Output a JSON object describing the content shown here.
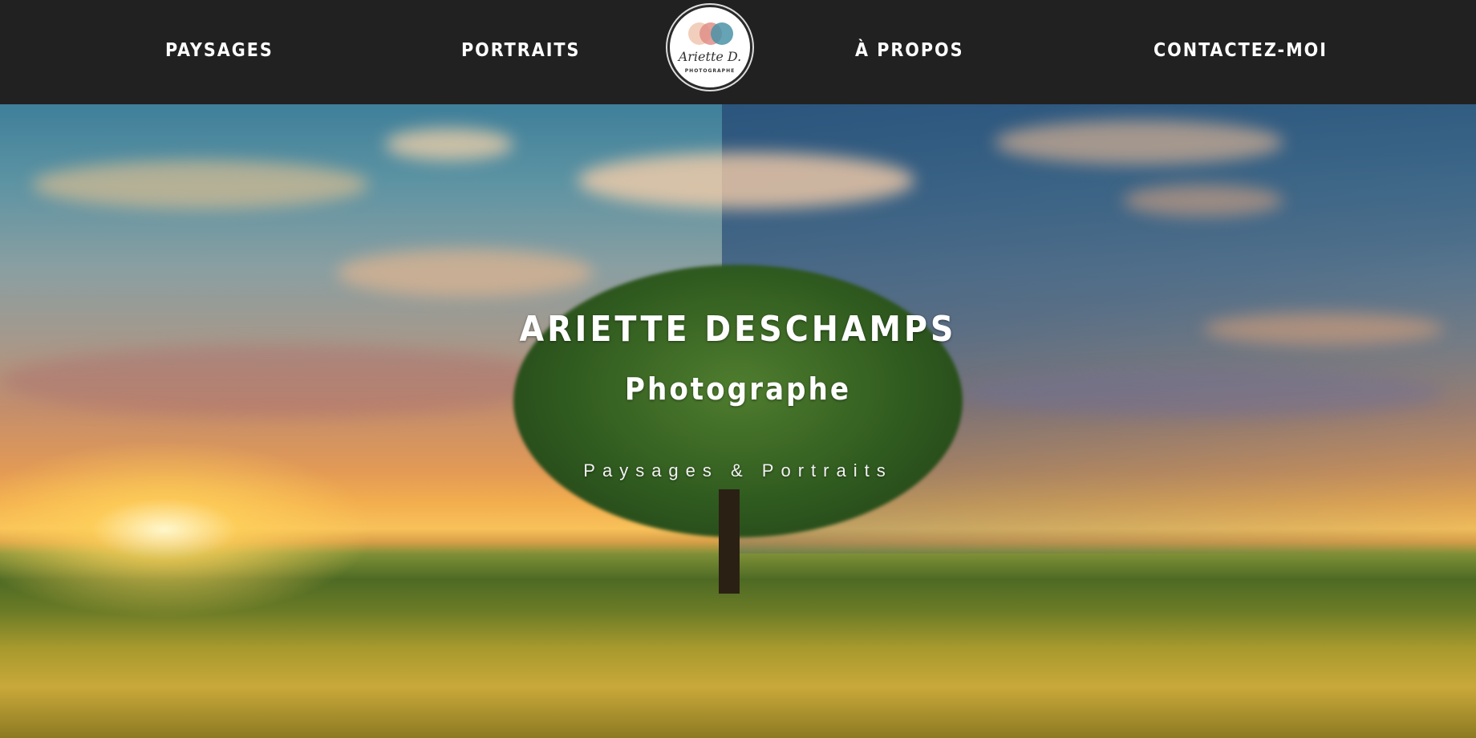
{
  "nav": {
    "items": [
      {
        "label": "PAYSAGES"
      },
      {
        "label": "PORTRAITS"
      },
      {
        "label": "À PROPOS"
      },
      {
        "label": "CONTACTEZ-MOI"
      }
    ],
    "logo": {
      "script_text": "Ariette D.",
      "small_text": "PHOTOGRAPHE"
    }
  },
  "hero": {
    "title": "ARIETTE DESCHAMPS",
    "subtitle": "Photographe",
    "tagline": "Paysages & Portraits"
  },
  "colors": {
    "navbar_bg": "#222121",
    "text": "#ffffff",
    "logo_dots": [
      "#f0c7b0",
      "#e08f87",
      "#4a93a8"
    ]
  }
}
